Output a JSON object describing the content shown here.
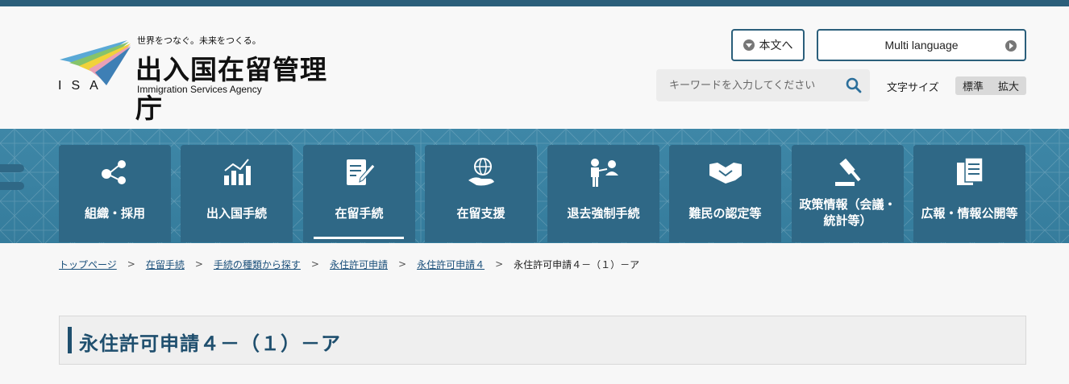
{
  "header": {
    "logo": {
      "isa": "ISA",
      "tagline": "世界をつなぐ。未来をつくる。",
      "name": "出入国在留管理庁",
      "name_en": "Immigration Services Agency"
    },
    "skip_button": "本文へ",
    "language_button": "Multi language",
    "search": {
      "placeholder": "キーワードを入力してください"
    },
    "font_size": {
      "label": "文字サイズ",
      "standard": "標準",
      "large": "拡大"
    }
  },
  "nav": {
    "items": [
      {
        "label": "組織・採用",
        "icon": "people-network-icon",
        "active": false
      },
      {
        "label": "出入国手続",
        "icon": "bar-chart-icon",
        "active": false
      },
      {
        "label": "在留手続",
        "icon": "document-edit-icon",
        "active": true
      },
      {
        "label": "在留支援",
        "icon": "globe-hand-icon",
        "active": false
      },
      {
        "label": "退去強制手続",
        "icon": "presentation-icon",
        "active": false
      },
      {
        "label": "難民の認定等",
        "icon": "handshake-icon",
        "active": false
      },
      {
        "label": "政策情報（会議・",
        "label2": "統計等）",
        "icon": "gavel-icon",
        "active": false
      },
      {
        "label": "広報・情報公開等",
        "icon": "documents-icon",
        "active": false
      }
    ]
  },
  "breadcrumb": [
    "トップページ",
    "在留手続",
    "手続の種類から探す",
    "永住許可申請",
    "永住許可申請４",
    "永住許可申請４－（１）－ア"
  ],
  "page": {
    "title": "永住許可申請４－（１）－ア"
  },
  "colors": {
    "brand": "#2b5f7b",
    "nav_tile": "#2f6886",
    "nav_band": "#3e87a7",
    "title": "#1f4f6e"
  }
}
